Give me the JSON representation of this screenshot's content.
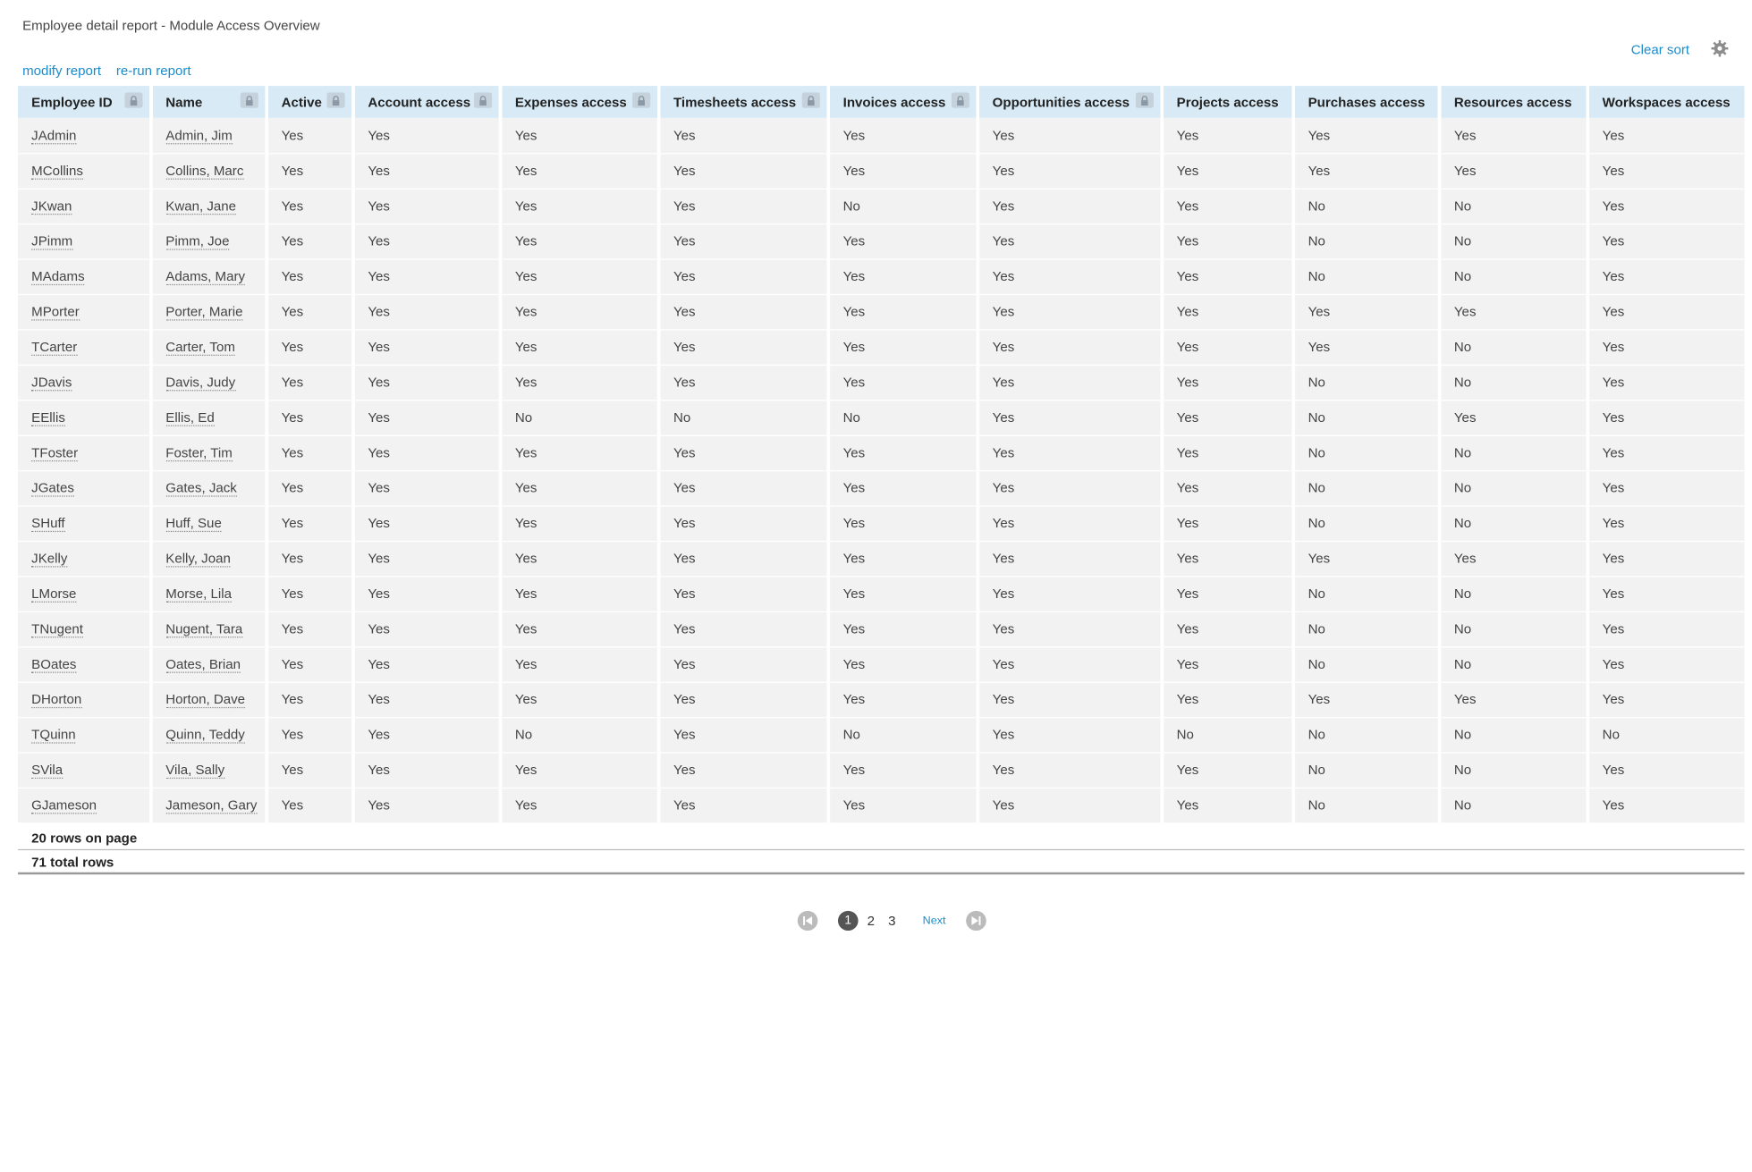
{
  "header": {
    "title": "Employee detail report - Module Access Overview",
    "modify_label": "modify report",
    "rerun_label": "re-run report",
    "clear_sort_label": "Clear sort",
    "settings_icon": "gear-icon"
  },
  "table": {
    "columns": [
      "Employee ID",
      "Name",
      "Active",
      "Account access",
      "Expenses access",
      "Timesheets access",
      "Invoices access",
      "Opportunities access",
      "Projects access",
      "Purchases access",
      "Resources access",
      "Workspaces access"
    ],
    "locked_columns": [
      true,
      true,
      true,
      true,
      true,
      true,
      true,
      true,
      false,
      false,
      false,
      false
    ],
    "rows": [
      [
        "JAdmin",
        "Admin, Jim",
        "Yes",
        "Yes",
        "Yes",
        "Yes",
        "Yes",
        "Yes",
        "Yes",
        "Yes",
        "Yes",
        "Yes"
      ],
      [
        "MCollins",
        "Collins, Marc",
        "Yes",
        "Yes",
        "Yes",
        "Yes",
        "Yes",
        "Yes",
        "Yes",
        "Yes",
        "Yes",
        "Yes"
      ],
      [
        "JKwan",
        "Kwan, Jane",
        "Yes",
        "Yes",
        "Yes",
        "Yes",
        "No",
        "Yes",
        "Yes",
        "No",
        "No",
        "Yes"
      ],
      [
        "JPimm",
        "Pimm, Joe",
        "Yes",
        "Yes",
        "Yes",
        "Yes",
        "Yes",
        "Yes",
        "Yes",
        "No",
        "No",
        "Yes"
      ],
      [
        "MAdams",
        "Adams, Mary",
        "Yes",
        "Yes",
        "Yes",
        "Yes",
        "Yes",
        "Yes",
        "Yes",
        "No",
        "No",
        "Yes"
      ],
      [
        "MPorter",
        "Porter, Marie",
        "Yes",
        "Yes",
        "Yes",
        "Yes",
        "Yes",
        "Yes",
        "Yes",
        "Yes",
        "Yes",
        "Yes"
      ],
      [
        "TCarter",
        "Carter, Tom",
        "Yes",
        "Yes",
        "Yes",
        "Yes",
        "Yes",
        "Yes",
        "Yes",
        "Yes",
        "No",
        "Yes"
      ],
      [
        "JDavis",
        "Davis, Judy",
        "Yes",
        "Yes",
        "Yes",
        "Yes",
        "Yes",
        "Yes",
        "Yes",
        "No",
        "No",
        "Yes"
      ],
      [
        "EEllis",
        "Ellis, Ed",
        "Yes",
        "Yes",
        "No",
        "No",
        "No",
        "Yes",
        "Yes",
        "No",
        "Yes",
        "Yes"
      ],
      [
        "TFoster",
        "Foster, Tim",
        "Yes",
        "Yes",
        "Yes",
        "Yes",
        "Yes",
        "Yes",
        "Yes",
        "No",
        "No",
        "Yes"
      ],
      [
        "JGates",
        "Gates, Jack",
        "Yes",
        "Yes",
        "Yes",
        "Yes",
        "Yes",
        "Yes",
        "Yes",
        "No",
        "No",
        "Yes"
      ],
      [
        "SHuff",
        "Huff, Sue",
        "Yes",
        "Yes",
        "Yes",
        "Yes",
        "Yes",
        "Yes",
        "Yes",
        "No",
        "No",
        "Yes"
      ],
      [
        "JKelly",
        "Kelly, Joan",
        "Yes",
        "Yes",
        "Yes",
        "Yes",
        "Yes",
        "Yes",
        "Yes",
        "Yes",
        "Yes",
        "Yes"
      ],
      [
        "LMorse",
        "Morse, Lila",
        "Yes",
        "Yes",
        "Yes",
        "Yes",
        "Yes",
        "Yes",
        "Yes",
        "No",
        "No",
        "Yes"
      ],
      [
        "TNugent",
        "Nugent, Tara",
        "Yes",
        "Yes",
        "Yes",
        "Yes",
        "Yes",
        "Yes",
        "Yes",
        "No",
        "No",
        "Yes"
      ],
      [
        "BOates",
        "Oates, Brian",
        "Yes",
        "Yes",
        "Yes",
        "Yes",
        "Yes",
        "Yes",
        "Yes",
        "No",
        "No",
        "Yes"
      ],
      [
        "DHorton",
        "Horton, Dave",
        "Yes",
        "Yes",
        "Yes",
        "Yes",
        "Yes",
        "Yes",
        "Yes",
        "Yes",
        "Yes",
        "Yes"
      ],
      [
        "TQuinn",
        "Quinn, Teddy",
        "Yes",
        "Yes",
        "No",
        "Yes",
        "No",
        "Yes",
        "No",
        "No",
        "No",
        "No"
      ],
      [
        "SVila",
        "Vila, Sally",
        "Yes",
        "Yes",
        "Yes",
        "Yes",
        "Yes",
        "Yes",
        "Yes",
        "No",
        "No",
        "Yes"
      ],
      [
        "GJameson",
        "Jameson, Gary",
        "Yes",
        "Yes",
        "Yes",
        "Yes",
        "Yes",
        "Yes",
        "Yes",
        "No",
        "No",
        "Yes"
      ]
    ]
  },
  "summary": {
    "rows_on_page": "20 rows on page",
    "total_rows": "71 total rows"
  },
  "pagination": {
    "pages": [
      "1",
      "2",
      "3"
    ],
    "current": "1",
    "next_label": "Next",
    "first_icon": "first-page-icon",
    "last_icon": "last-page-icon"
  },
  "colors": {
    "link": "#1a8ccc",
    "header_bg": "#d7eaf6",
    "row_bg": "#f2f2f2"
  }
}
